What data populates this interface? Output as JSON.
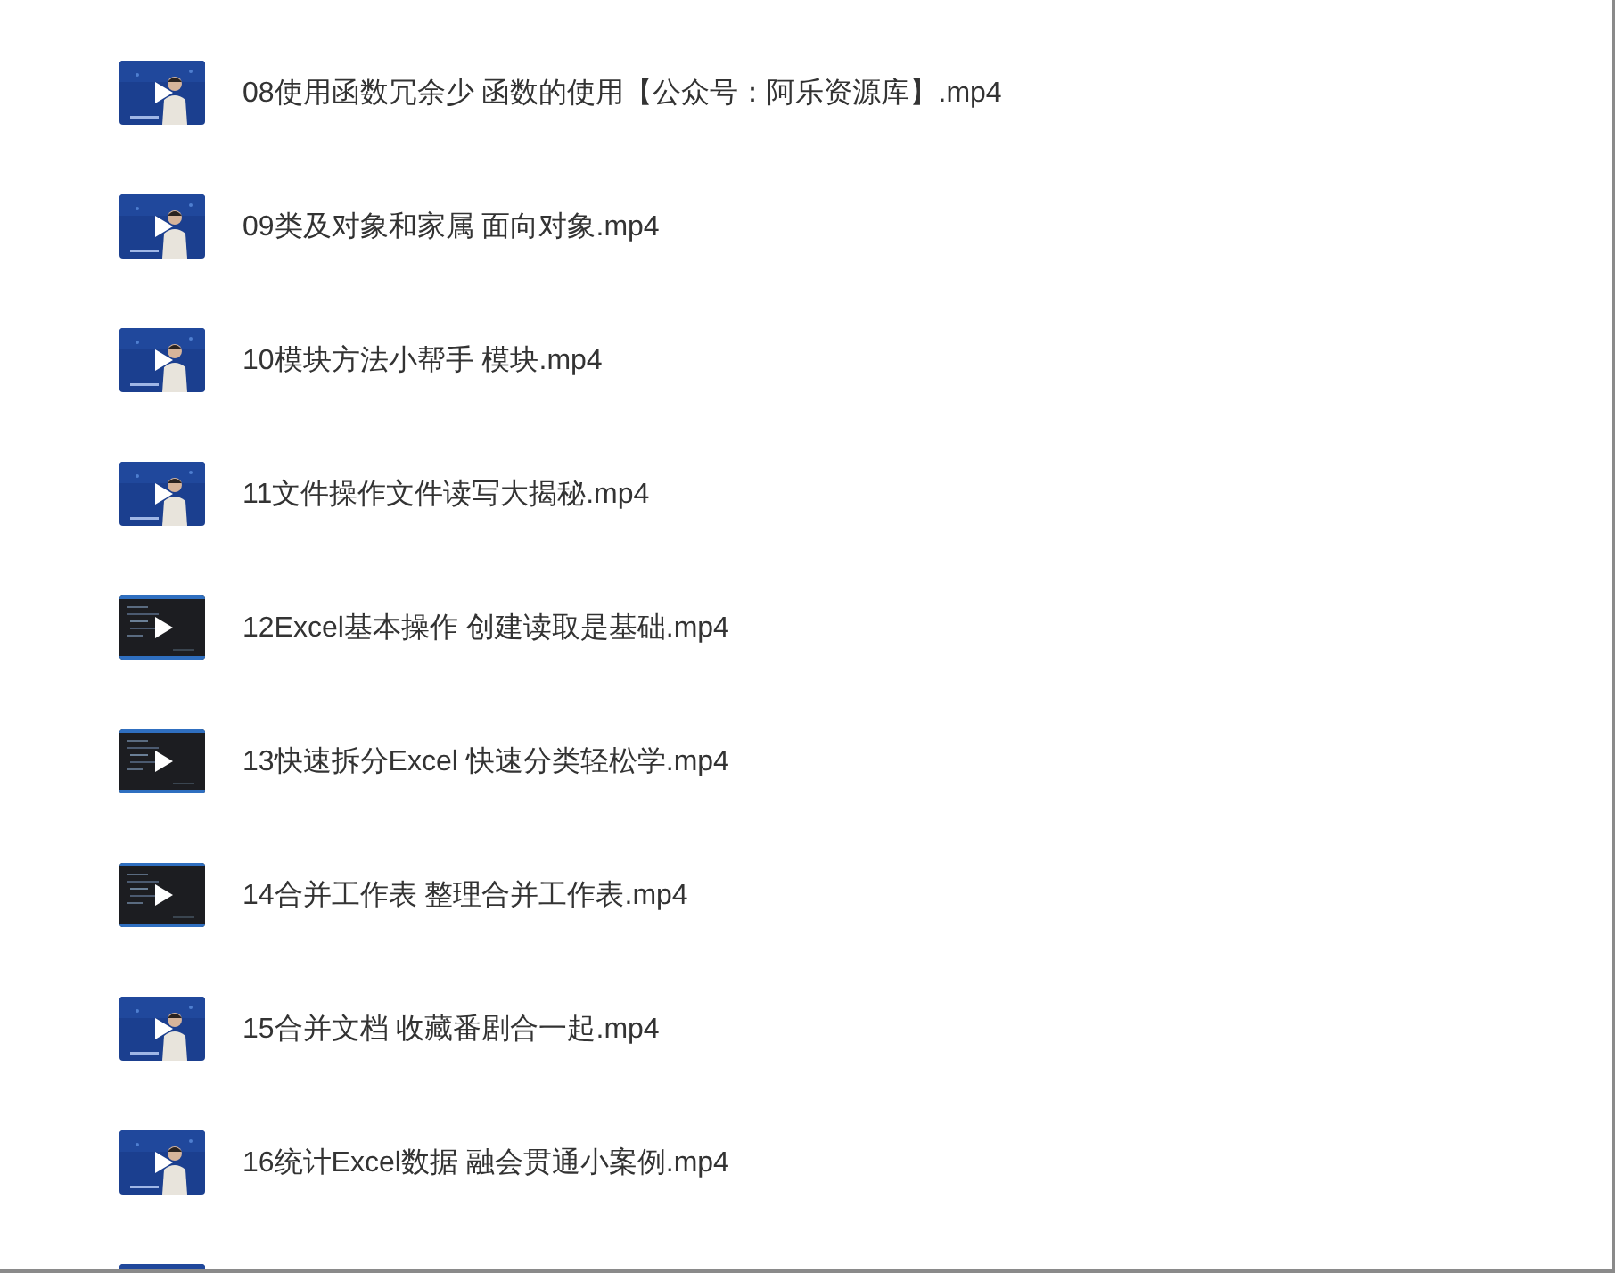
{
  "files": [
    {
      "kind": "presenter",
      "name": "08使用函数冗余少 函数的使用【公众号：阿乐资源库】.mp4"
    },
    {
      "kind": "presenter",
      "name": "09类及对象和家属 面向对象.mp4"
    },
    {
      "kind": "presenter",
      "name": "10模块方法小帮手 模块.mp4"
    },
    {
      "kind": "presenter",
      "name": "11文件操作文件读写大揭秘.mp4"
    },
    {
      "kind": "code",
      "name": "12Excel基本操作 创建读取是基础.mp4"
    },
    {
      "kind": "code",
      "name": "13快速拆分Excel 快速分类轻松学.mp4"
    },
    {
      "kind": "code",
      "name": "14合并工作表 整理合并工作表.mp4"
    },
    {
      "kind": "presenter",
      "name": "15合并文档 收藏番剧合一起.mp4"
    },
    {
      "kind": "presenter",
      "name": "16统计Excel数据 融会贯通小案例.mp4"
    },
    {
      "kind": "presenter"
    }
  ]
}
